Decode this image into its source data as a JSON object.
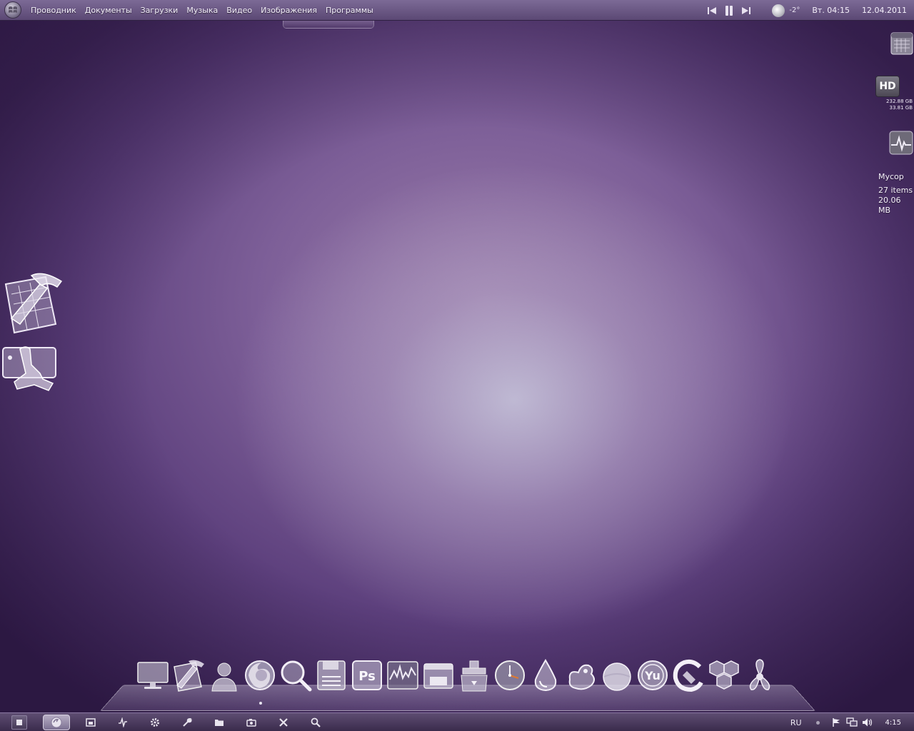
{
  "menubar": {
    "items": [
      {
        "label": "Проводник"
      },
      {
        "label": "Документы"
      },
      {
        "label": "Загрузки"
      },
      {
        "label": "Музыка"
      },
      {
        "label": "Видео"
      },
      {
        "label": "Изображения"
      },
      {
        "label": "Программы"
      }
    ],
    "weather_temp": "-2°",
    "day_time": "Вт. 04:15",
    "date": "12.04.2011"
  },
  "widgets": {
    "hd_label": "HD",
    "hd_total": "232.88 GB",
    "hd_free": "33.81 GB",
    "trash_title": "Мусор",
    "trash_items": "27 items",
    "trash_size": "20.06 MB"
  },
  "dock": {
    "icons": [
      "monitor-icon",
      "xcode-icon",
      "user-icon",
      "firefox-icon",
      "magnifier-icon",
      "floppy-icon",
      "photoshop-icon",
      "activity-monitor-icon",
      "finder-icon",
      "archive-icon",
      "clock-icon",
      "drop-icon",
      "paw-icon",
      "ball-icon",
      "yu-icon",
      "cleaner-icon",
      "hexagons-icon",
      "fan-icon"
    ],
    "photoshop_label": "Ps",
    "yu_label": "Yu"
  },
  "taskbar": {
    "language": "RU",
    "clock": "4:15"
  }
}
